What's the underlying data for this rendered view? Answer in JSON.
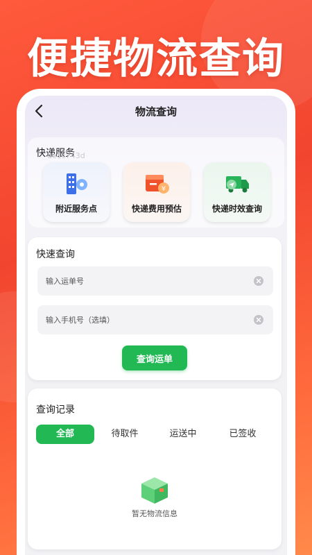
{
  "hero": {
    "title": "便捷物流查询"
  },
  "nav": {
    "title": "物流查询"
  },
  "services": {
    "title": "快递服务",
    "watermark": "de1c743d",
    "items": [
      {
        "label": "附近服务点",
        "icon": "building-location-icon"
      },
      {
        "label": "快递费用预估",
        "icon": "package-price-icon"
      },
      {
        "label": "快递时效查询",
        "icon": "delivery-truck-icon"
      }
    ]
  },
  "query": {
    "title": "快速查询",
    "tracking_placeholder": "输入运单号",
    "phone_placeholder": "输入手机号（选填）",
    "button_label": "查询运单"
  },
  "records": {
    "title": "查询记录",
    "tabs": [
      {
        "label": "全部",
        "active": true
      },
      {
        "label": "待取件",
        "active": false
      },
      {
        "label": "运送中",
        "active": false
      },
      {
        "label": "已签收",
        "active": false
      }
    ],
    "empty_text": "暂无物流信息"
  },
  "colors": {
    "accent_green": "#22b955",
    "background_red": "#f2452f"
  }
}
